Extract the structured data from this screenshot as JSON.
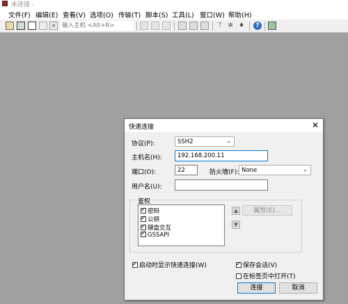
{
  "window": {
    "title": "未连接 - "
  },
  "menu": [
    "文件(F)",
    "编辑(E)",
    "查看(V)",
    "选项(O)",
    "传输(T)",
    "脚本(S)",
    "工具(L)",
    "窗口(W)",
    "帮助(H)"
  ],
  "toolbar": {
    "quick_connect_placeholder": "输入主机 <Alt+R>"
  },
  "dialog": {
    "title": "快速连接",
    "protocol_label": "协议(P):",
    "protocol_value": "SSH2",
    "hostname_label": "主机名(H):",
    "hostname_value": "192.168.200.11",
    "port_label": "端口(O):",
    "port_value": "22",
    "firewall_label": "防火墙(F):",
    "firewall_value": "None",
    "username_label": "用户名(U):",
    "username_value": "",
    "auth_group_label": "鉴权",
    "auth_methods": [
      {
        "label": "密码",
        "checked": true
      },
      {
        "label": "公钥",
        "checked": true
      },
      {
        "label": "键盘交互",
        "checked": true
      },
      {
        "label": "GSSAPI",
        "checked": true
      }
    ],
    "properties_button": "属性(E)...",
    "show_on_startup": {
      "label": "启动时显示快速连接(W)",
      "checked": true
    },
    "save_session": {
      "label": "保存会话(V)",
      "checked": true
    },
    "open_in_tab": {
      "label": "在标签页中打开(T)",
      "checked": false
    },
    "connect_button": "连接",
    "cancel_button": "取消"
  }
}
